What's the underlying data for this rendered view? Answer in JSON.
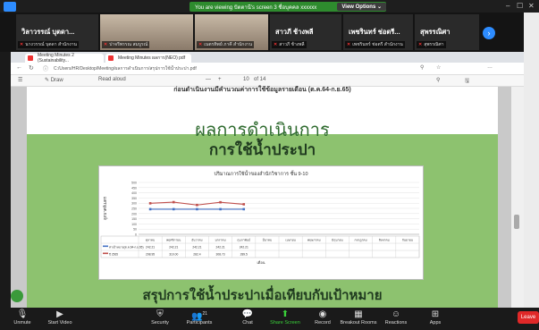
{
  "zoom": {
    "share_banner": "You are viewing ปัตตานี's screen 3 ชื่อบุคคล xxxxxx",
    "view_options": "View Options",
    "participants": [
      {
        "name": "วิลาวรรณ์ บุตดา...",
        "sub": "นางวรรณ์ บุตดา สำนักงาน",
        "video": false
      },
      {
        "name": "",
        "sub": "ปาจรีพรรณ สมบูรณ์",
        "video": true
      },
      {
        "name": "",
        "sub": "เนตรทิพย์ ภาคี สำนักงาน",
        "video": true
      },
      {
        "name": "สาวภี ช้างพลี",
        "sub": "สาวภี ช้างพลี",
        "video": false
      },
      {
        "name": "เพชรินทร์ ช่อตรี...",
        "sub": "เพชรินทร์ ช่อตรี สำนักงาน",
        "video": false
      },
      {
        "name": "สุพรรณิศา",
        "sub": "สุพรรณิศา",
        "video": false
      }
    ],
    "toolbar": [
      {
        "icon": "microphone-icon",
        "label": "Unmute"
      },
      {
        "icon": "video-icon",
        "label": "Start Video"
      },
      {
        "icon": "shield-icon",
        "label": "Security"
      },
      {
        "icon": "participants-icon",
        "label": "Participants"
      },
      {
        "icon": "chat-icon",
        "label": "Chat"
      },
      {
        "icon": "share-screen-icon",
        "label": "Share Screen"
      },
      {
        "icon": "record-icon",
        "label": "Record"
      },
      {
        "icon": "breakout-rooms-icon",
        "label": "Breakout Rooms"
      },
      {
        "icon": "reactions-icon",
        "label": "Reactions"
      },
      {
        "icon": "apps-icon",
        "label": "Apps"
      }
    ],
    "leave": "Leave",
    "participants_count": "21"
  },
  "browser": {
    "tabs": [
      "Meeting Minutes 2 (Sustainability...",
      "Meeting Minutes ผลการ(NEO) pdf"
    ],
    "url": "C:/Users/HR/Desktop/Meeting/ผลการดำเนินการ/สรุปการใช้น้ำประปา.pdf",
    "pdf_draw": "Draw",
    "pdf_read_aloud": "Read aloud",
    "page_info": "of 14",
    "page_num": "10"
  },
  "pdf": {
    "top_caption": "ก่อนดำเนินงานมีคำนวณค่าการใช้ข้อมูลรายเดือน (ต.ค.64-ก.ย.65)",
    "title": "ผลการดำเนินการ",
    "subtitle": "การใช้น้ำประปา",
    "section2": "สรุปการใช้น้ำประปาเมื่อเทียบกับเป้าหมาย"
  },
  "chart_data": {
    "type": "line",
    "title": "ปริมาณการใช้น้ำของสำนักวิชาการ ชั้น 9-10",
    "ylabel": "ลูกบาศก์เมตร",
    "xlabel": "เดือน",
    "ylim": [
      0,
      500
    ],
    "yticks": [
      0,
      50,
      100,
      150,
      200,
      250,
      300,
      350,
      400,
      450,
      500
    ],
    "categories": [
      "ตุลาคม",
      "พฤศจิกายน",
      "ธันวาคม",
      "มกราคม",
      "กุมภาพันธ์",
      "มีนาคม",
      "เมษายน",
      "พฤษภาคม",
      "มิถุนายน",
      "กรกฎาคม",
      "สิงหาคม",
      "กันยายน"
    ],
    "series": [
      {
        "name": "ค่าเป้าหมาย(ต.ค.64-ก.ย.65)",
        "color": "#4472c4",
        "values": [
          242.21,
          242.21,
          242.21,
          242.21,
          242.21,
          null,
          null,
          null,
          null,
          null,
          null,
          null
        ],
        "labels": [
          "242.21",
          "242.21",
          "242.21",
          "242.21",
          "242.21",
          "",
          "",
          "",
          "",
          "",
          "",
          ""
        ]
      },
      {
        "name": "ปี 2565",
        "color": "#c0504d",
        "values": [
          298.95,
          310.0,
          282.4,
          308.73,
          289.5,
          null,
          null,
          null,
          null,
          null,
          null,
          null
        ],
        "labels": [
          "298.95",
          "310.00",
          "282.4",
          "308.73",
          "289.5",
          "",
          "",
          "",
          "",
          "",
          "",
          ""
        ]
      }
    ]
  }
}
